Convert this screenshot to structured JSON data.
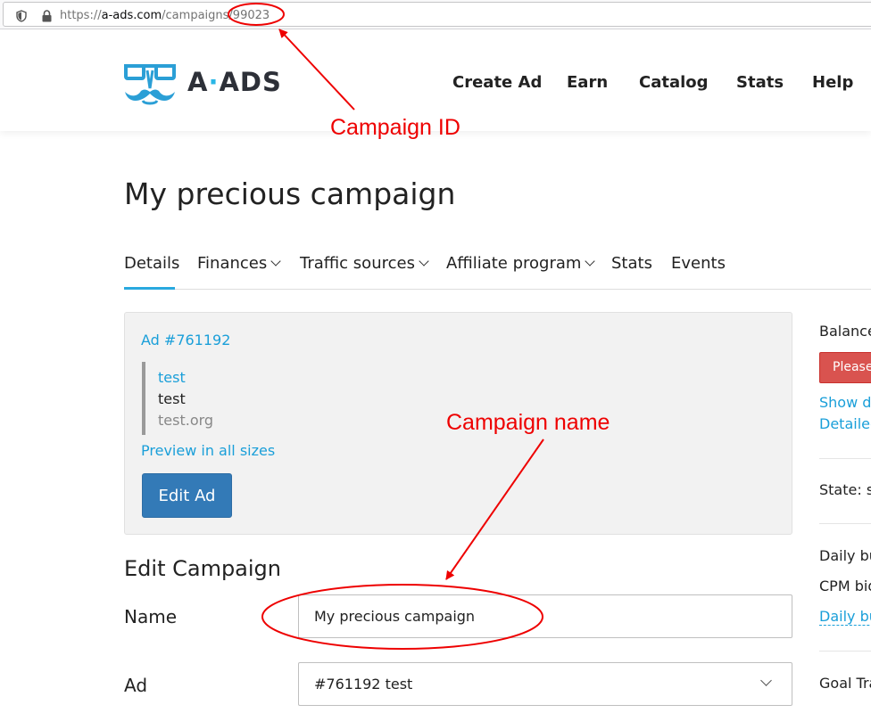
{
  "browser": {
    "url_scheme": "https://",
    "url_host": "a-ads.com",
    "url_path": "/campaigns/",
    "url_id": "99023"
  },
  "header": {
    "brand_a": "A",
    "brand_ads": "ADS",
    "nav": [
      "Create Ad",
      "Earn",
      "Catalog",
      "Stats",
      "Help"
    ]
  },
  "page": {
    "title": "My precious campaign"
  },
  "tabs": [
    {
      "label": "Details",
      "active": true
    },
    {
      "label": "Finances",
      "dropdown": true
    },
    {
      "label": "Traffic sources",
      "dropdown": true
    },
    {
      "label": "Affiliate program",
      "dropdown": true
    },
    {
      "label": "Stats"
    },
    {
      "label": "Events"
    }
  ],
  "ad_panel": {
    "ad_id": "Ad #761192",
    "title": "test",
    "text": "test",
    "domain": "test.org",
    "preview_link": "Preview in all sizes",
    "edit_button": "Edit Ad"
  },
  "form": {
    "section_title": "Edit Campaign",
    "name_label": "Name",
    "name_value": "My precious campaign",
    "ad_label": "Ad",
    "ad_value": "#761192 test"
  },
  "sidebar": {
    "balance": "Balance",
    "please_btn": "Please",
    "show_link": "Show de",
    "detailed_link": "Detailed",
    "state": "State: st",
    "daily_budget": "Daily bu",
    "cpm_bid": "CPM bid",
    "daily_link": "Daily bu",
    "goal": "Goal Tra"
  },
  "annotations": {
    "campaign_id": "Campaign ID",
    "campaign_name": "Campaign name"
  },
  "colors": {
    "accent": "#1a9fd9",
    "primary_button": "#337ab7",
    "danger": "#d9534f",
    "annotation": "#ee0000"
  }
}
